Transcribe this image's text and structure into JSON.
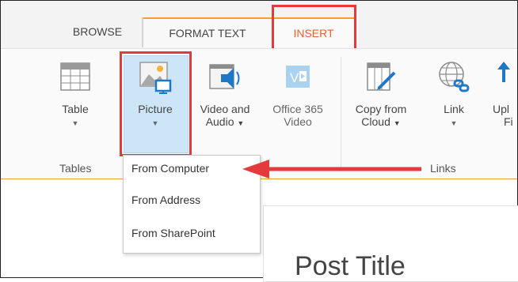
{
  "tabs": {
    "browse": "BROWSE",
    "format_text": "FORMAT TEXT",
    "insert": "INSERT"
  },
  "ribbon": {
    "buttons": {
      "table": {
        "label": "Table"
      },
      "picture": {
        "label": "Picture"
      },
      "video_audio": {
        "line1": "Video and",
        "line2": "Audio"
      },
      "office365": {
        "line1": "Office 365",
        "line2": "Video"
      },
      "copy_cloud": {
        "line1": "Copy from",
        "line2": "Cloud"
      },
      "link": {
        "label": "Link"
      },
      "upload": {
        "line1": "Upl",
        "line2": "Fi"
      }
    },
    "groups": {
      "tables": "Tables",
      "links": "Links"
    }
  },
  "picture_menu": {
    "items": [
      "From Computer",
      "From Address",
      "From SharePoint"
    ]
  },
  "content": {
    "post_title": "Post Title"
  },
  "colors": {
    "accent": "#e8612c",
    "highlight": "#e33b3b",
    "tab_border": "#f0a030",
    "picture_bg": "#cde6f7"
  }
}
